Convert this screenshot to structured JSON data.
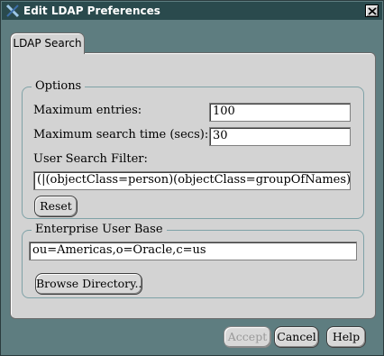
{
  "window": {
    "title": "Edit LDAP Preferences",
    "app_icon": "x-logo-icon",
    "close_icon": "close-icon"
  },
  "tabs": [
    {
      "label": "LDAP Search",
      "selected": true
    }
  ],
  "options": {
    "legend": "Options",
    "max_entries_label": "Maximum entries:",
    "max_entries_value": "100",
    "max_time_label": "Maximum search time (secs):",
    "max_time_value": "30",
    "filter_label": "User Search Filter:",
    "filter_value": "(|(objectClass=person)(objectClass=groupOfNames)(objectClas",
    "reset_label": "Reset"
  },
  "user_base": {
    "legend": "Enterprise User Base",
    "value": "ou=Americas,o=Oracle,c=us",
    "browse_label": "Browse Directory.."
  },
  "footer": {
    "accept_label": "Accept",
    "accept_enabled": false,
    "cancel_label": "Cancel",
    "help_label": "Help"
  },
  "colors": {
    "background": "#5e7d80",
    "titlebar": "#2a4a4d",
    "panel": "#d3d3d3",
    "group_border": "#7fa2a7"
  }
}
